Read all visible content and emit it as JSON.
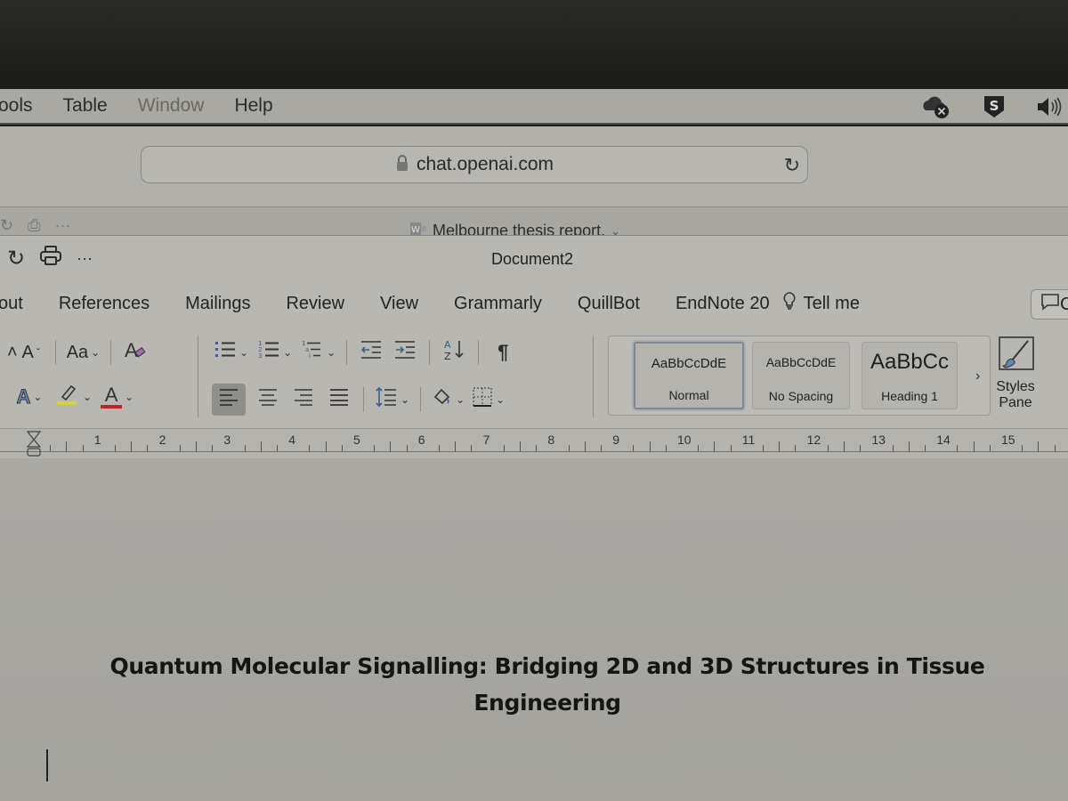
{
  "menubar": {
    "items": [
      "ools",
      "Table",
      "Window",
      "Help"
    ],
    "tray": {
      "cloud": "cloud-error-icon",
      "shield": "sophos-shield-icon",
      "volume": "volume-icon"
    }
  },
  "browser": {
    "url": "chat.openai.com",
    "lock_icon": "lock-icon",
    "reload_icon": "reload-icon"
  },
  "background_window": {
    "title": "Melbourne thesis report."
  },
  "word": {
    "title": "Document2",
    "quick_access": [
      "redo-icon",
      "print-icon",
      "more-icon"
    ],
    "tabs": [
      "out",
      "References",
      "Mailings",
      "Review",
      "View",
      "Grammarly",
      "QuillBot",
      "EndNote 20",
      "Tell me"
    ],
    "comments_label": "C",
    "ribbon": {
      "font_size_up_label": "A",
      "change_case_label": "Aa",
      "clear_formatting_label": "A",
      "text_effects_label": "A",
      "font_color_label": "A",
      "sort_label": "A↓Z",
      "show_marks_label": "¶",
      "highlight_color": "#d6d23a",
      "font_color": "#c0242a"
    },
    "styles": [
      {
        "sample": "AaBbCcDdE",
        "name": "Normal",
        "selected": true
      },
      {
        "sample": "AaBbCcDdE",
        "name": "No Spacing",
        "selected": false
      },
      {
        "sample": "AaBbCc",
        "name": "Heading 1",
        "selected": false
      }
    ],
    "gallery_next": "›",
    "styles_pane_label": "Styles\nPane",
    "styles_pane_line1": "Styles",
    "styles_pane_line2": "Pane",
    "ruler_numbers": [
      "1",
      "2",
      "3",
      "4",
      "5",
      "6",
      "7",
      "8",
      "9",
      "10",
      "11",
      "12",
      "13",
      "14",
      "15"
    ]
  },
  "document": {
    "heading": "Quantum Molecular Signalling: Bridging 2D and 3D Structures in Tissue Engineering"
  }
}
